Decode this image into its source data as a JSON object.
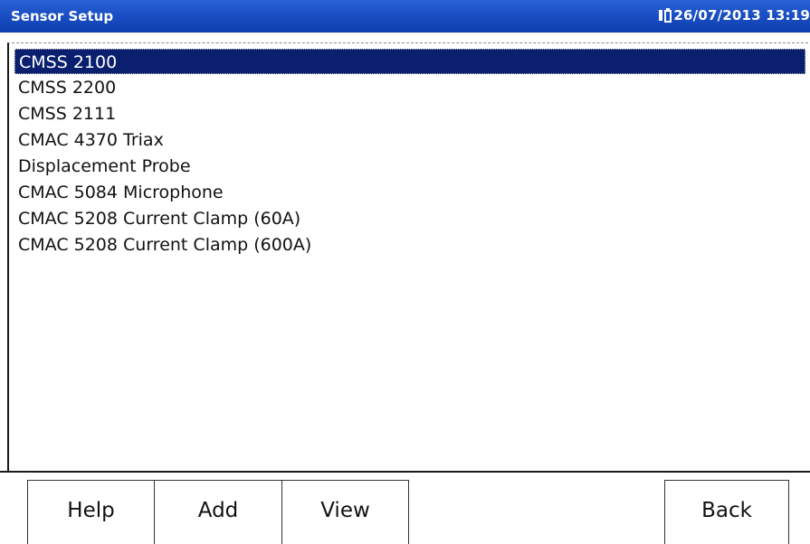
{
  "window": {
    "title": "Sensor Setup",
    "datetime": "26/07/2013 13:19"
  },
  "sensor_list": {
    "selected_index": 0,
    "items": [
      "CMSS 2100",
      "CMSS 2200",
      "CMSS 2111",
      "CMAC 4370 Triax",
      "Displacement Probe",
      "CMAC 5084 Microphone",
      "CMAC 5208 Current Clamp (60A)",
      "CMAC 5208 Current Clamp (600A)"
    ]
  },
  "buttons": {
    "help": "Help",
    "add": "Add",
    "view": "View",
    "back": "Back"
  },
  "colors": {
    "titlebar": "#1a4fc4",
    "selection": "#0a1f6e"
  },
  "icons": {
    "status": "battery-power-icon"
  }
}
